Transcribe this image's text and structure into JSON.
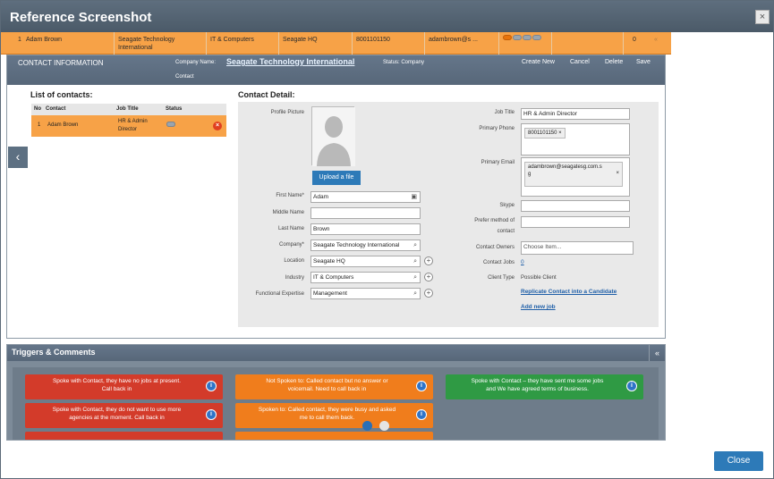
{
  "modal": {
    "title": "Reference Screenshot",
    "close_icon": "×",
    "close_button": "Close"
  },
  "orange_row": {
    "no": "1",
    "name": "Adam Brown",
    "company": "Seagate Technology International",
    "industry": "IT & Computers",
    "location": "Seagate HQ",
    "phone": "8001101150",
    "email": "adambrown@s ...",
    "count": "0",
    "collapse": "«"
  },
  "header": {
    "title": "CONTACT INFORMATION",
    "company_label": "Company Name:",
    "company_name": "Seagate Technology International",
    "status": "Status: Company",
    "status2": "Contact",
    "buttons": {
      "create": "Create New",
      "cancel": "Cancel",
      "delete": "Delete",
      "save": "Save"
    }
  },
  "contacts": {
    "title": "List of contacts:",
    "columns": [
      "No",
      "Contact",
      "Job Title",
      "Status"
    ],
    "rows": [
      {
        "no": "1",
        "name": "Adam Brown",
        "job": "HR & Admin Director"
      }
    ]
  },
  "detail": {
    "title": "Contact Detail:",
    "labels": {
      "profile": "Profile Picture",
      "first": "First Name*",
      "middle": "Middle Name",
      "last": "Last Name",
      "company": "Company*",
      "location": "Location",
      "industry": "Industry",
      "expertise": "Functional Expertise",
      "job_title": "Job Title",
      "phone": "Primary Phone",
      "email": "Primary Email",
      "skype": "Skype",
      "prefer_1": "Prefer method of",
      "prefer_2": "contact",
      "owners": "Contact Owners",
      "jobs": "Contact Jobs",
      "client_type": "Client Type"
    },
    "values": {
      "upload": "Upload a file",
      "first": "Adam",
      "middle": "",
      "last": "Brown",
      "company": "Seagate Technology International",
      "location": "Seagate HQ",
      "industry": "IT & Computers",
      "expertise": "Management",
      "job_title": "HR & Admin Director",
      "phone": "8001101150",
      "email_1": "adambrown@seagatesg.com.s",
      "email_2": "g",
      "skype": "",
      "prefer": "",
      "owners_placeholder": "Choose Item...",
      "jobs": "0",
      "client_type": "Possible Client",
      "link_replicate": "Replicate Contact into a Candidate",
      "link_add_job": "Add new job",
      "tag_close": "×"
    }
  },
  "triggers": {
    "title": "Triggers & Comments",
    "collapse": "«",
    "buttons": [
      {
        "l1": "Spoke with Contact, they have no jobs at present.",
        "l2": "Call back in"
      },
      {
        "l1": "Not Spoken to: Called contact but no answer or",
        "l2": "voicemail. Need to call back in"
      },
      {
        "l1": "Spoke with Contact – they have sent me some jobs",
        "l2": "and We have agreed terms of business."
      },
      {
        "l1": "Spoke with Contact, they do not want to use more",
        "l2": "agencies at the moment. Call back in"
      },
      {
        "l1": "Spoken to: Called contact, they were busy and asked",
        "l2": "me to call them back."
      }
    ],
    "info_glyph": "i"
  },
  "icons": {
    "back": "‹",
    "search": "⌕",
    "plus": "+",
    "card": "▣",
    "delete": "×"
  }
}
